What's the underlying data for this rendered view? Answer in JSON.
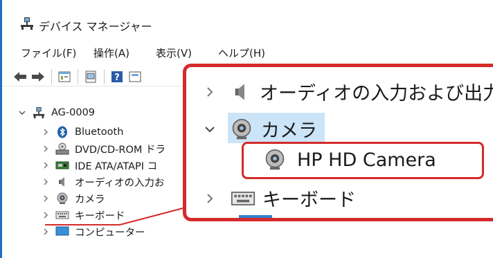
{
  "window": {
    "title": "デバイス マネージャー"
  },
  "menu": [
    "ファイル(F)",
    "操作(A)",
    "表示(V)",
    "ヘルプ(H)"
  ],
  "tree": {
    "root": "AG-0009",
    "items": [
      {
        "label": "Bluetooth",
        "icon": "bluetooth-icon"
      },
      {
        "label": "DVD/CD-ROM ドラ",
        "icon": "dvd-drive-icon"
      },
      {
        "label": "IDE ATA/ATAPI コ",
        "icon": "ide-controller-icon"
      },
      {
        "label": "オーディオの入力お",
        "icon": "audio-icon"
      },
      {
        "label": "カメラ",
        "icon": "camera-icon"
      },
      {
        "label": "キーボード",
        "icon": "keyboard-icon"
      },
      {
        "label": "コンピューター",
        "icon": "computer-icon"
      }
    ]
  },
  "zoom": {
    "audio": "オーディオの入力および出力",
    "camera": "カメラ",
    "device": "HP HD Camera",
    "keyboard": "キーボード"
  },
  "colors": {
    "highlight": "#d42a2a",
    "selection": "#cce4f7",
    "accent": "#1e6fc0"
  }
}
